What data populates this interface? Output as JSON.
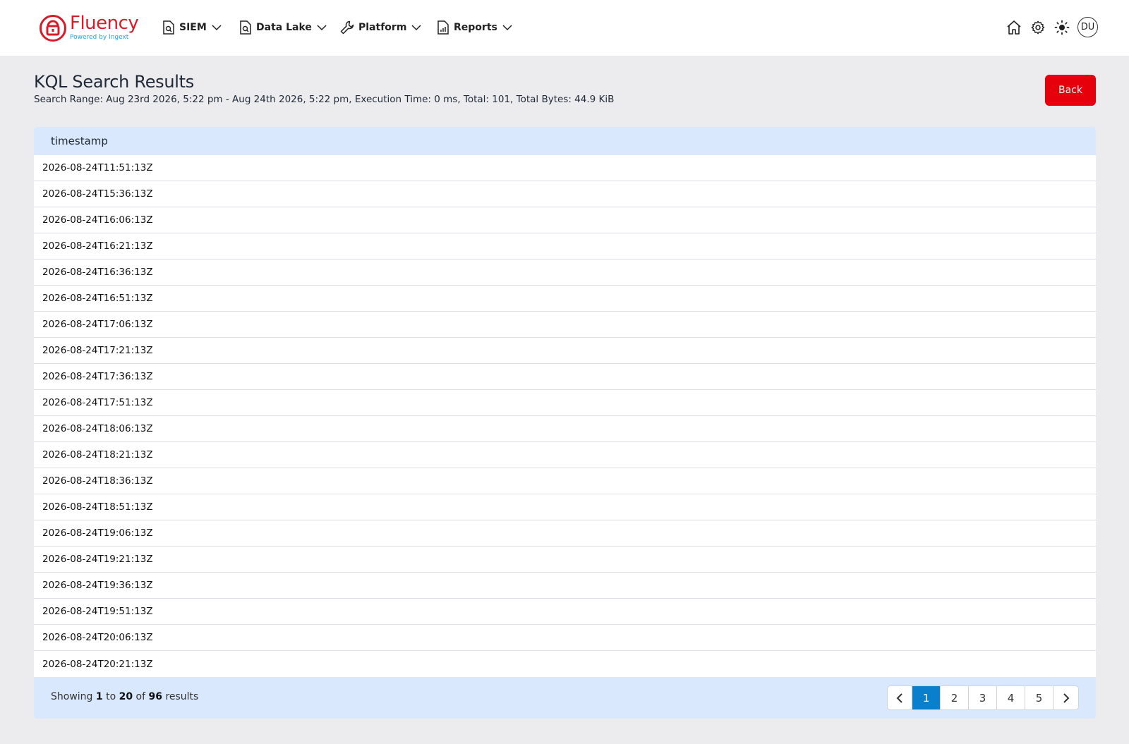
{
  "brand": {
    "name": "Fluency",
    "tagline": "Powered by Ingext"
  },
  "nav": [
    {
      "label": "SIEM",
      "icon": "search-document-icon"
    },
    {
      "label": "Data Lake",
      "icon": "search-document-icon"
    },
    {
      "label": "Platform",
      "icon": "wrench-icon"
    },
    {
      "label": "Reports",
      "icon": "report-document-icon"
    }
  ],
  "header_icons": [
    "home-icon",
    "gear-icon",
    "sun-icon"
  ],
  "user": {
    "initials": "DU"
  },
  "page": {
    "title": "KQL Search Results",
    "meta": "Search Range: Aug 23rd 2026, 5:22 pm - Aug 24th 2026, 5:22 pm, Execution Time: 0 ms, Total: 101, Total Bytes: 44.9 KiB",
    "back_label": "Back"
  },
  "table": {
    "columns": [
      "timestamp"
    ],
    "rows": [
      "2026-08-24T11:51:13Z",
      "2026-08-24T15:36:13Z",
      "2026-08-24T16:06:13Z",
      "2026-08-24T16:21:13Z",
      "2026-08-24T16:36:13Z",
      "2026-08-24T16:51:13Z",
      "2026-08-24T17:06:13Z",
      "2026-08-24T17:21:13Z",
      "2026-08-24T17:36:13Z",
      "2026-08-24T17:51:13Z",
      "2026-08-24T18:06:13Z",
      "2026-08-24T18:21:13Z",
      "2026-08-24T18:36:13Z",
      "2026-08-24T18:51:13Z",
      "2026-08-24T19:06:13Z",
      "2026-08-24T19:21:13Z",
      "2026-08-24T19:36:13Z",
      "2026-08-24T19:51:13Z",
      "2026-08-24T20:06:13Z",
      "2026-08-24T20:21:13Z"
    ]
  },
  "footer": {
    "showing_prefix": "Showing",
    "from": "1",
    "to_word": "to",
    "to": "20",
    "of_word": "of",
    "total": "96",
    "suffix": "results"
  },
  "pagination": {
    "pages": [
      "1",
      "2",
      "3",
      "4",
      "5"
    ],
    "current": "1",
    "prev_icon": "chevron-left-icon",
    "next_icon": "chevron-right-icon"
  },
  "colors": {
    "brand": "#d81b28",
    "accent_blue": "#0a7fcb",
    "header_fill": "#d9e8fc",
    "back_button": "#e5000b"
  }
}
